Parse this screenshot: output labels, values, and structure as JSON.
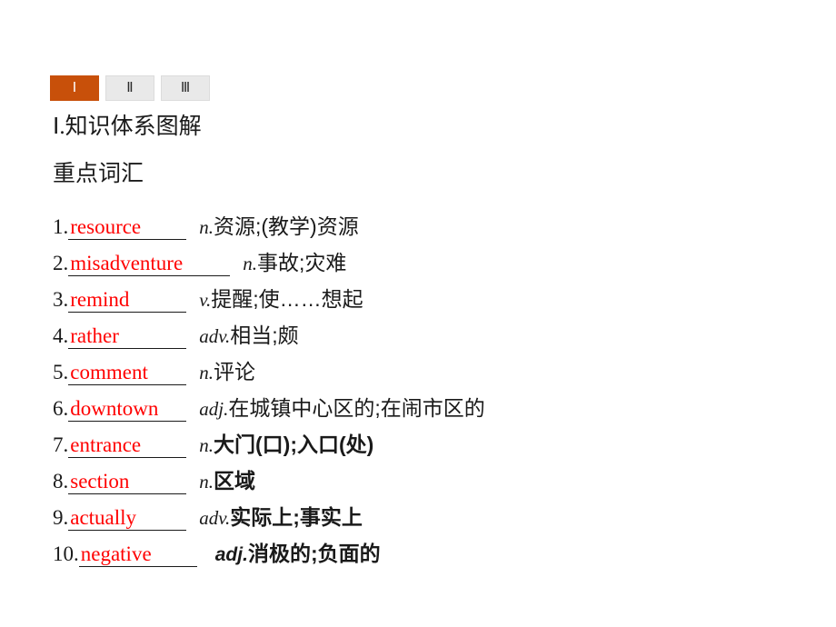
{
  "tabs": [
    {
      "label": "Ⅰ",
      "active": true
    },
    {
      "label": "Ⅱ",
      "active": false
    },
    {
      "label": "Ⅲ",
      "active": false
    }
  ],
  "headings": {
    "section": "Ⅰ.知识体系图解",
    "subsection": "重点词汇"
  },
  "colors": {
    "active_tab_bg": "#c8500a",
    "active_tab_text": "#ffffff",
    "inactive_tab_bg": "#e9e9e9",
    "inactive_tab_text": "#2b2b2b",
    "answer_text": "#ff0000",
    "body_text": "#1a1a1a",
    "page_bg": "#ffffff"
  },
  "vocabulary": [
    {
      "index": "1.",
      "answer": "resource",
      "pos": "n.",
      "meaning": "资源;(教学)资源"
    },
    {
      "index": "2.",
      "answer": "misadventure",
      "pos": "n.",
      "meaning": "事故;灾难"
    },
    {
      "index": "3.",
      "answer": "remind",
      "pos": "v.",
      "meaning": "提醒;使……想起"
    },
    {
      "index": "4.",
      "answer": "rather",
      "pos": "adv.",
      "meaning": "相当;颇"
    },
    {
      "index": "5.",
      "answer": "comment",
      "pos": "n.",
      "meaning": "评论"
    },
    {
      "index": "6.",
      "answer": "downtown",
      "pos": "adj.",
      "meaning": "在城镇中心区的;在闹市区的"
    },
    {
      "index": "7.",
      "answer": "entrance",
      "pos": "n.",
      "meaning": "大门(口);入口(处)"
    },
    {
      "index": "8.",
      "answer": "section",
      "pos": "n.",
      "meaning": "区域"
    },
    {
      "index": "9.",
      "answer": "actually",
      "pos": "adv.",
      "meaning": "实际上;事实上"
    },
    {
      "index": "10.",
      "answer": "negative",
      "pos": "adj.",
      "meaning": "消极的;负面的"
    }
  ]
}
